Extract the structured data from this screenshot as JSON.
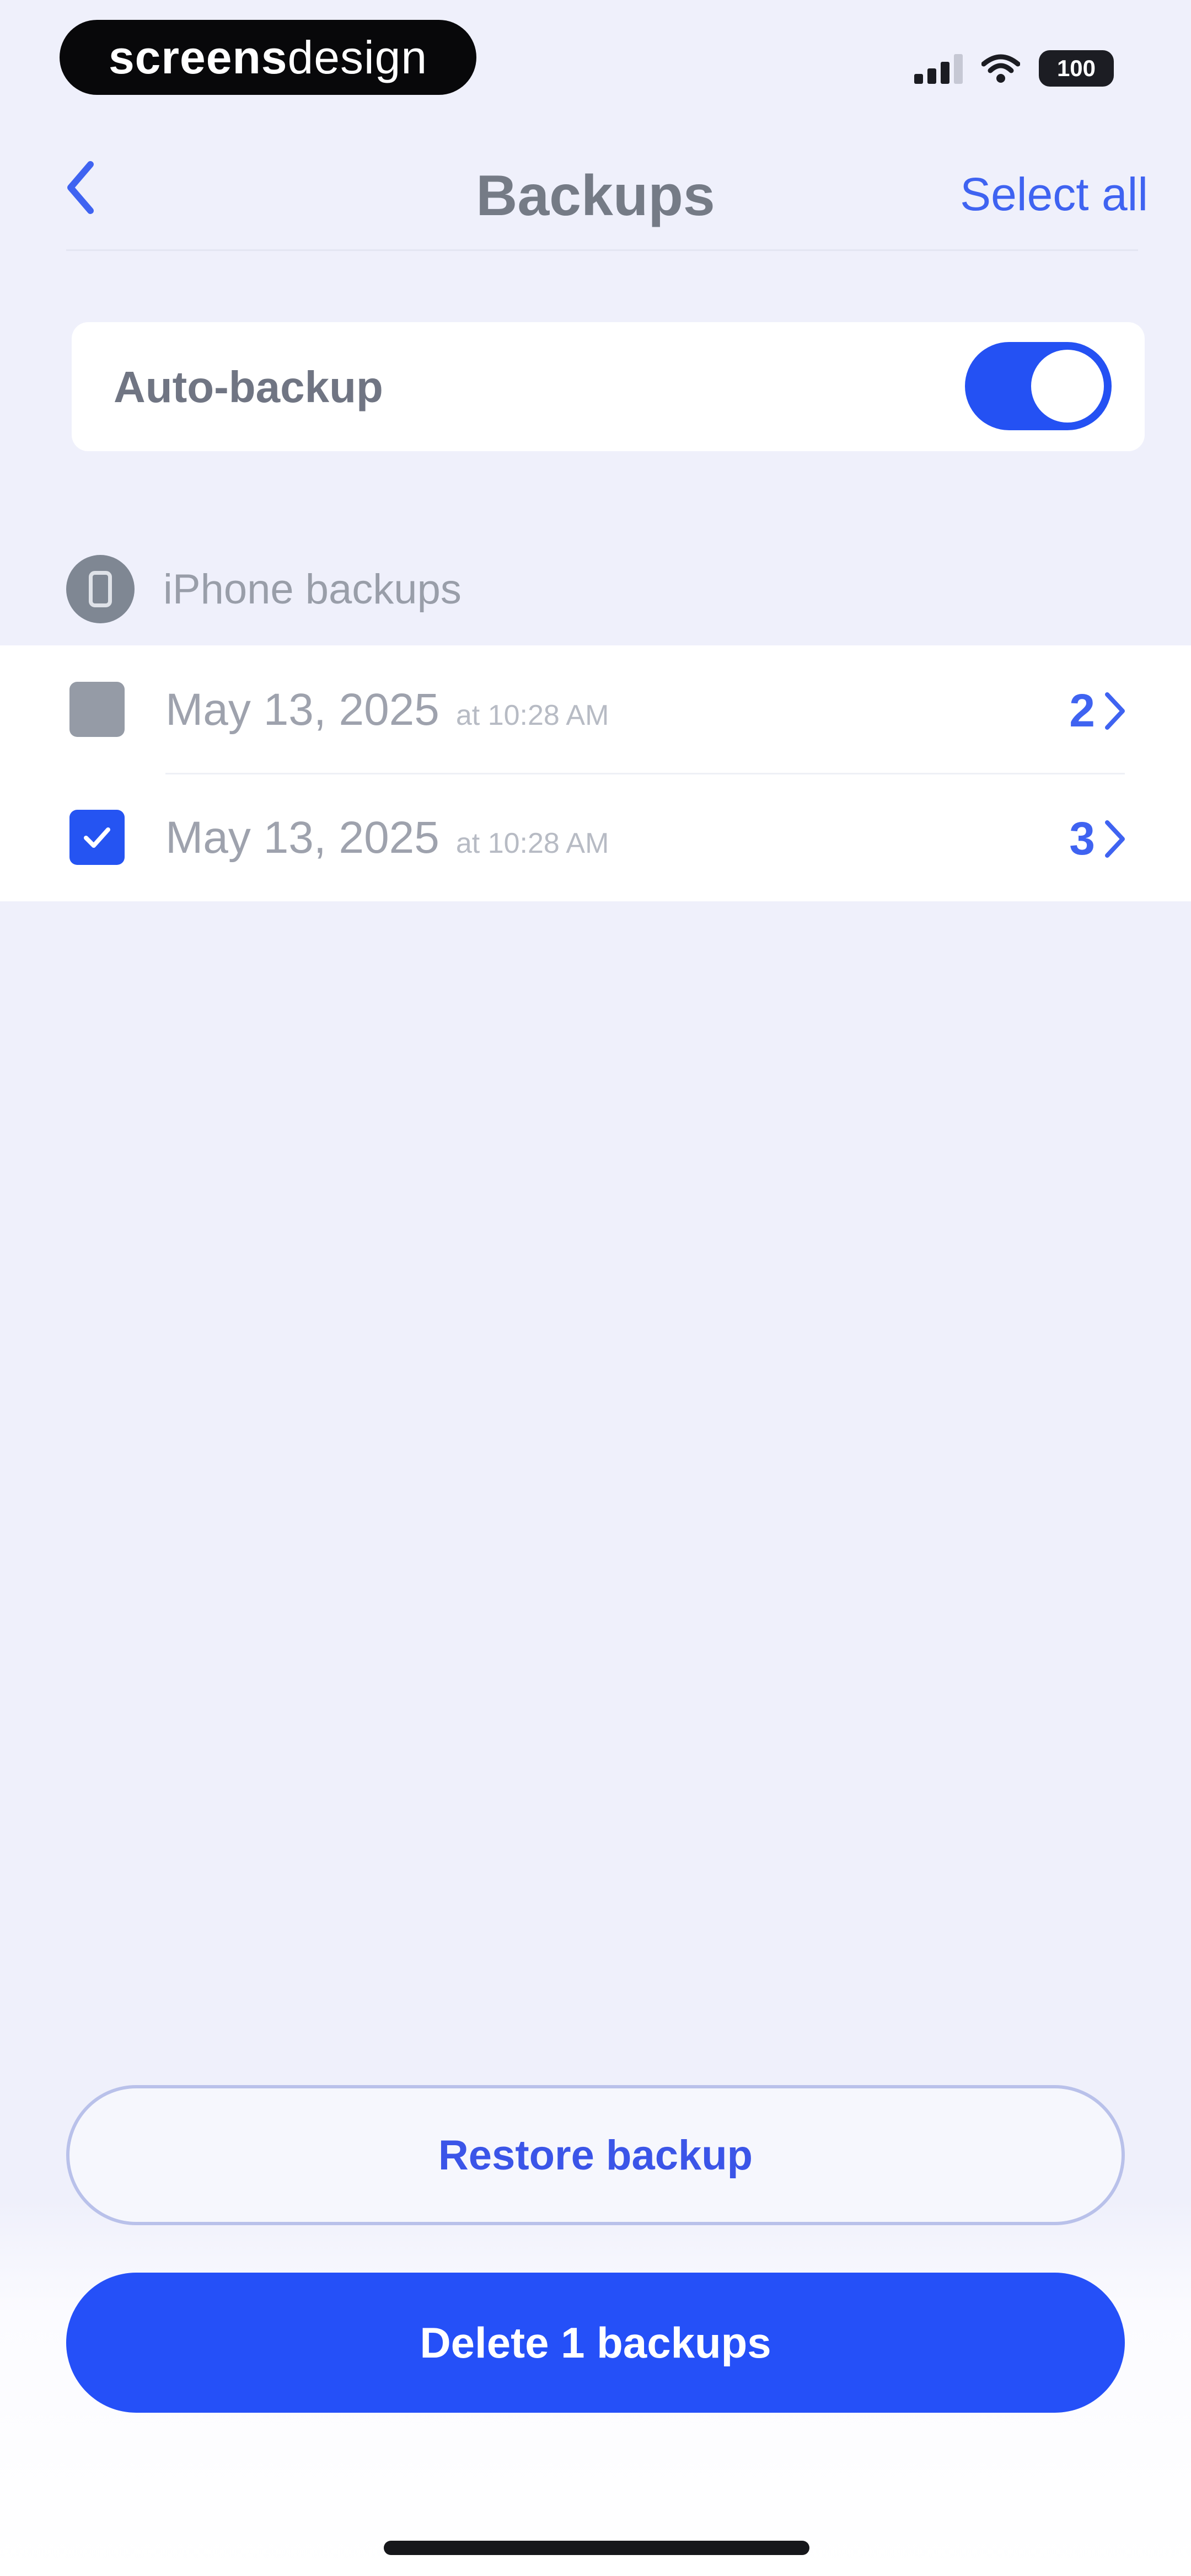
{
  "status_bar": {
    "brand_bold": "screens",
    "brand_light": "design",
    "battery": "100",
    "icons": [
      "cellular-signal-icon",
      "wifi-icon",
      "battery-icon"
    ]
  },
  "nav": {
    "back_icon": "chevron-left-icon",
    "title": "Backups",
    "select_all": "Select all"
  },
  "auto_backup": {
    "label": "Auto-backup",
    "enabled": true
  },
  "section": {
    "icon": "iphone-icon",
    "title": "iPhone backups"
  },
  "backups": [
    {
      "date": "May 13, 2025",
      "time": "at 10:28 AM",
      "count": "2",
      "checked": false
    },
    {
      "date": "May 13, 2025",
      "time": "at 10:28 AM",
      "count": "3",
      "checked": true
    }
  ],
  "actions": {
    "restore_label": "Restore backup",
    "delete_label": "Delete 1 backups"
  },
  "colors": {
    "accent": "#2550F8",
    "link": "#3F63F1",
    "background": "#EFF0FB",
    "unchecked": "#959BA6"
  }
}
